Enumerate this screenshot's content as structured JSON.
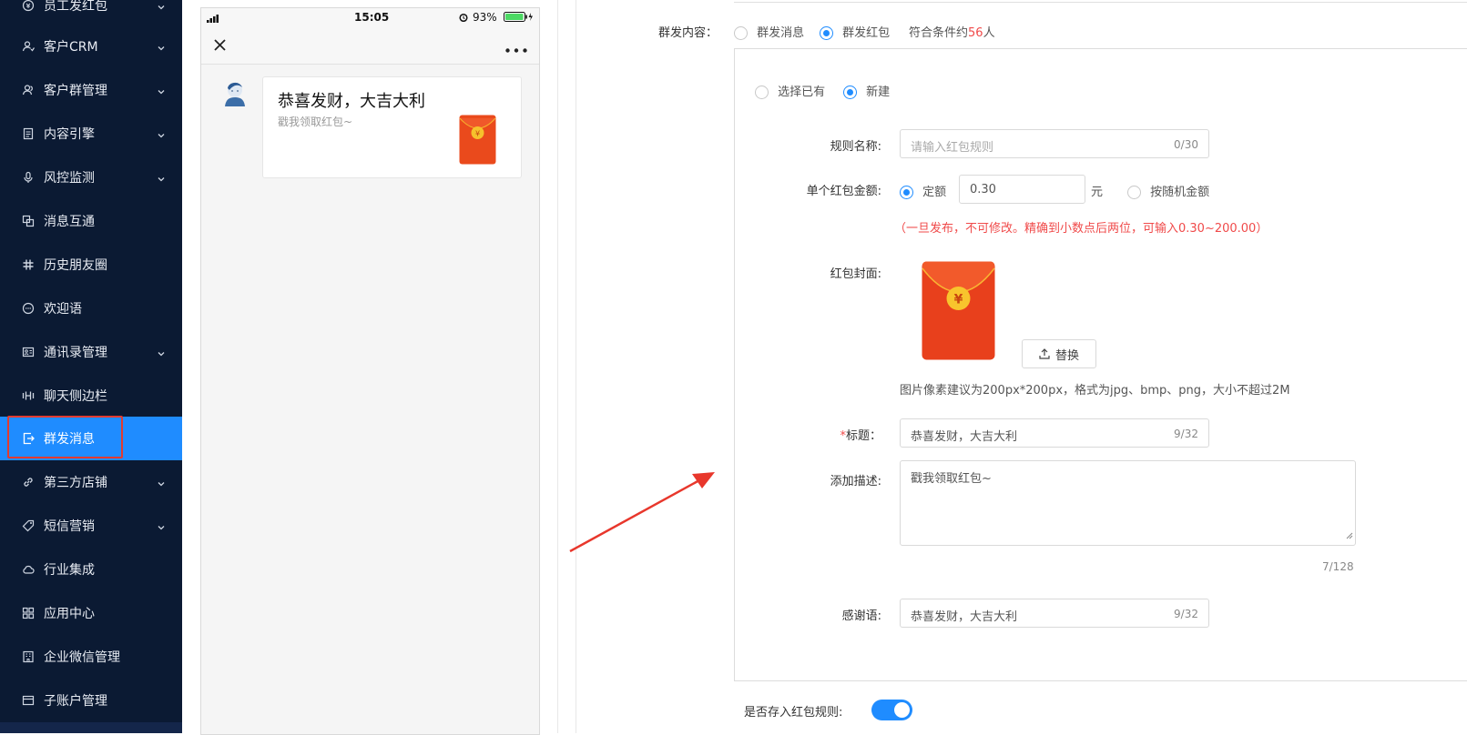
{
  "sidebar": {
    "items": [
      {
        "label": "员工发红包",
        "icon": "coin-icon",
        "chevron": true
      },
      {
        "label": "客户CRM",
        "icon": "user-icon",
        "chevron": true
      },
      {
        "label": "客户群管理",
        "icon": "users-icon",
        "chevron": true
      },
      {
        "label": "内容引擎",
        "icon": "document-icon",
        "chevron": true
      },
      {
        "label": "风控监测",
        "icon": "microphone-icon",
        "chevron": true
      },
      {
        "label": "消息互通",
        "icon": "copy-icon",
        "chevron": false
      },
      {
        "label": "历史朋友圈",
        "icon": "hashtag-icon",
        "chevron": false
      },
      {
        "label": "欢迎语",
        "icon": "chat-bubble-icon",
        "chevron": false
      },
      {
        "label": "通讯录管理",
        "icon": "contact-card-icon",
        "chevron": true
      },
      {
        "label": "聊天侧边栏",
        "icon": "sidebar-panel-icon",
        "chevron": false
      },
      {
        "label": "群发消息",
        "icon": "send-icon",
        "chevron": false,
        "active": true
      },
      {
        "label": "第三方店铺",
        "icon": "link-icon",
        "chevron": true
      },
      {
        "label": "短信营销",
        "icon": "tag-icon",
        "chevron": true
      },
      {
        "label": "行业集成",
        "icon": "cloud-icon",
        "chevron": false
      },
      {
        "label": "应用中心",
        "icon": "grid-icon",
        "chevron": false
      },
      {
        "label": "企业微信管理",
        "icon": "building-icon",
        "chevron": false
      },
      {
        "label": "子账户管理",
        "icon": "sub-account-icon",
        "chevron": false
      }
    ]
  },
  "phone": {
    "time": "15:05",
    "battery": "93%",
    "message_title": "恭喜发财，大吉大利",
    "message_desc": "戳我领取红包~"
  },
  "form": {
    "content_label": "群发内容：",
    "content_options": [
      "群发消息",
      "群发红包"
    ],
    "match_prefix": "符合条件约",
    "match_count": "56",
    "match_suffix": "人",
    "source_options": [
      "选择已有",
      "新建"
    ],
    "rule_name_label": "规则名称:",
    "rule_name_placeholder": "请输入红包规则",
    "rule_name_count": "0/30",
    "amount_label": "单个红包金额:",
    "amount_fixed": "定额",
    "amount_value": "0.30",
    "amount_unit": "元",
    "amount_random": "按随机金额",
    "amount_hint": "（一旦发布，不可修改。精确到小数点后两位，可输入0.30~200.00）",
    "cover_label": "红包封面:",
    "replace_button": "替换",
    "cover_hint": "图片像素建议为200px*200px，格式为jpg、bmp、png，大小不超过2M",
    "title_star": "*",
    "title_label": "标题：",
    "title_value": "恭喜发财，大吉大利",
    "title_count": "9/32",
    "desc_label": "添加描述:",
    "desc_value": "戳我领取红包~",
    "desc_count": "7/128",
    "thanks_label": "感谢语:",
    "thanks_value": "恭喜发财，大吉大利",
    "thanks_count": "9/32",
    "save_rule_label": "是否存入红包规则:",
    "save_rule_on": true
  },
  "colors": {
    "sidebar_bg": "#0b1a33",
    "accent": "#1f8cff",
    "warning": "#f04a4a",
    "highlight_box": "#e23b30",
    "arrow": "#e8372c",
    "redpacket": "#e8401c",
    "coin": "#f6c12c"
  }
}
